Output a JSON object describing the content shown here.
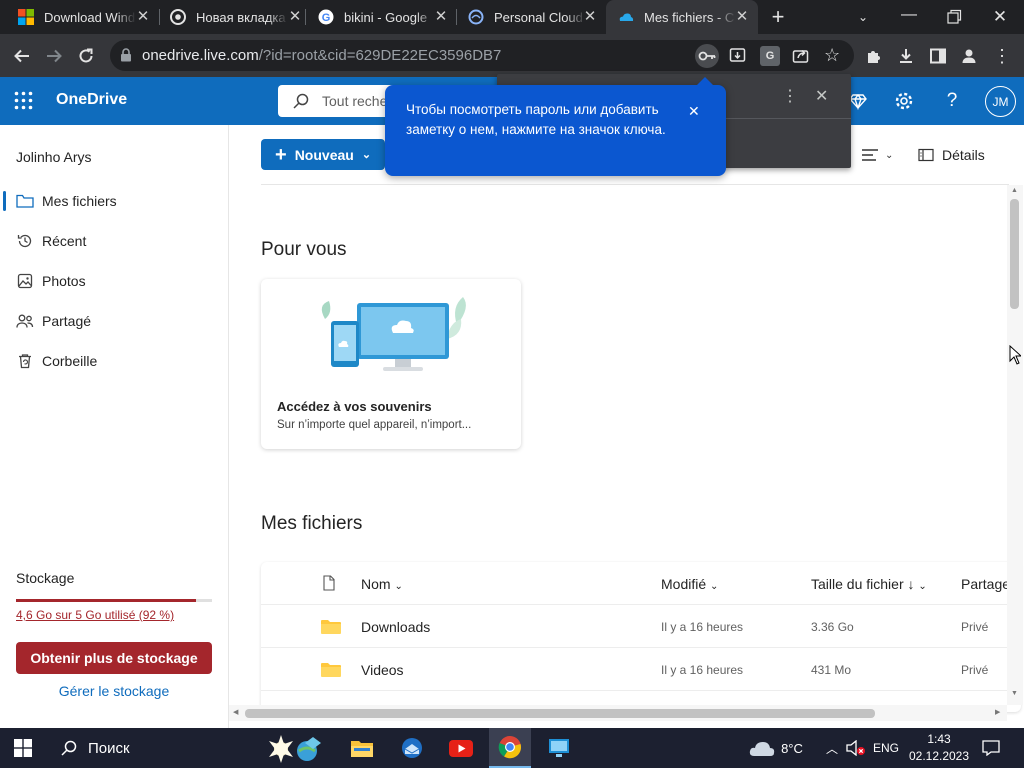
{
  "browser": {
    "tabs": [
      {
        "label": "Download Wind",
        "icon": "windows-logo-icon",
        "active": false
      },
      {
        "label": "Новая вкладка",
        "icon": "chrome-icon",
        "active": false
      },
      {
        "label": "bikini - Google",
        "icon": "google-icon",
        "active": false
      },
      {
        "label": "Personal Cloud",
        "icon": "cloud-globe-icon",
        "active": false
      },
      {
        "label": "Mes fichiers - C",
        "icon": "onedrive-icon",
        "active": true
      }
    ],
    "url_host": "onedrive.live.com",
    "url_rest": "/?id=root&cid=629DE22EC3596DB7"
  },
  "password_bubble": {
    "text": "Чтобы посмотреть пароль или добавить заметку о нем, нажмите на значок ключа."
  },
  "onedrive": {
    "brand": "OneDrive",
    "search_placeholder": "Tout reche",
    "avatar_initials": "JM",
    "accent": "#0f6cbd"
  },
  "sidebar": {
    "user": "Jolinho Arys",
    "items": [
      {
        "label": "Mes fichiers",
        "icon": "folder-icon",
        "selected": true
      },
      {
        "label": "Récent",
        "icon": "history-icon",
        "selected": false
      },
      {
        "label": "Photos",
        "icon": "photo-icon",
        "selected": false
      },
      {
        "label": "Partagé",
        "icon": "people-icon",
        "selected": false
      },
      {
        "label": "Corbeille",
        "icon": "recycle-bin-icon",
        "selected": false
      }
    ],
    "storage_title": "Stockage",
    "storage_text": "4,6 Go sur 5 Go utilisé (92 %)",
    "storage_fraction": 0.92,
    "get_storage_label": "Obtenir plus de stockage",
    "manage_storage_label": "Gérer le stockage",
    "storage_color": "#a4262c"
  },
  "toolbar": {
    "new_label": "Nouveau",
    "details_label": "Détails"
  },
  "for_you": {
    "heading": "Pour vous",
    "card_title": "Accédez à vos souvenirs",
    "card_sub": "Sur n’importe quel appareil, n’import..."
  },
  "files": {
    "heading": "Mes fichiers",
    "columns": {
      "name": "Nom",
      "modified": "Modifié",
      "size": "Taille du fichier",
      "sharing": "Partage"
    },
    "rows": [
      {
        "name": "Downloads",
        "modified": "Il y a 16 heures",
        "size": "3.36 Go",
        "sharing": "Privé"
      },
      {
        "name": "Videos",
        "modified": "Il y a 16 heures",
        "size": "431 Mo",
        "sharing": "Privé"
      }
    ]
  },
  "taskbar": {
    "search_label": "Поиск",
    "weather": "8°C",
    "lang": "ENG",
    "time": "1:43",
    "date": "02.12.2023"
  }
}
